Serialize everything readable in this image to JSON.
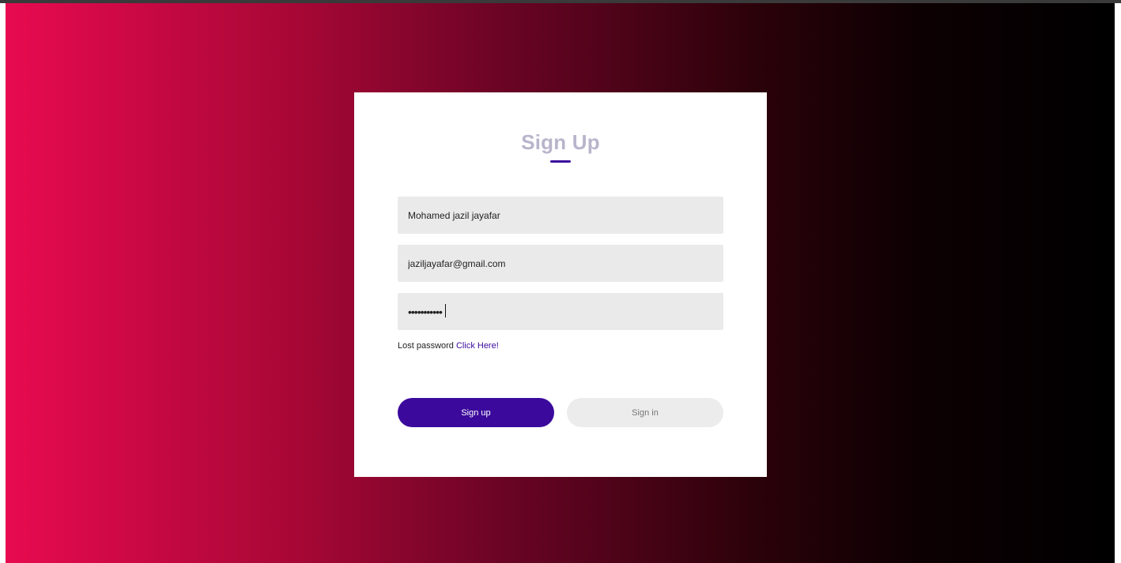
{
  "form": {
    "title": "Sign Up",
    "name_value": "Mohamed jazil jayafar",
    "email_value": "jaziljayafar@gmail.com",
    "password_masked": "•••••••••••",
    "lost_password_text": "Lost password",
    "lost_password_link": "Click Here!",
    "signup_label": "Sign up",
    "signin_label": "Sign in"
  },
  "colors": {
    "accent": "#3b0a9d",
    "gradient_start": "#e80a50",
    "gradient_end": "#000000",
    "field_bg": "#eaeaea"
  }
}
